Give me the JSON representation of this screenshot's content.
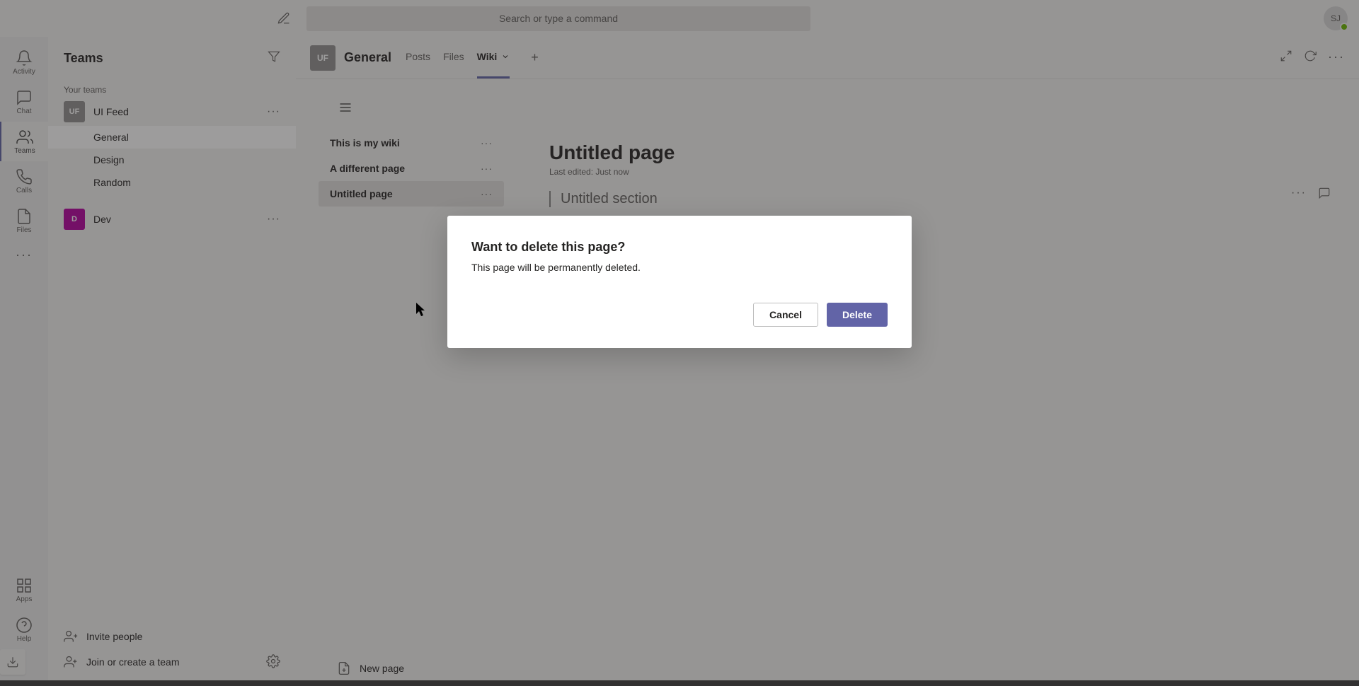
{
  "title_bar": {
    "search_placeholder": "Search or type a command",
    "user_initials": "SJ"
  },
  "app_rail": {
    "items": [
      {
        "label": "Activity"
      },
      {
        "label": "Chat"
      },
      {
        "label": "Teams"
      },
      {
        "label": "Calls"
      },
      {
        "label": "Files"
      }
    ],
    "help_label": "Help"
  },
  "sidebar": {
    "title": "Teams",
    "section_label": "Your teams",
    "teams": [
      {
        "avatar": "UF",
        "name": "UI Feed",
        "channels": [
          "General",
          "Design",
          "Random"
        ]
      },
      {
        "avatar": "D",
        "name": "Dev"
      }
    ],
    "invite_label": "Invite people",
    "join_label": "Join or create a team"
  },
  "channel_header": {
    "avatar": "UF",
    "name": "General",
    "tabs": [
      "Posts",
      "Files",
      "Wiki"
    ]
  },
  "wiki": {
    "pages": [
      {
        "title": "This is my wiki"
      },
      {
        "title": "A different page"
      },
      {
        "title": "Untitled page"
      }
    ],
    "new_page_label": "New page",
    "page_title": "Untitled page",
    "last_edited": "Last edited: Just now",
    "section_title": "Untitled section"
  },
  "modal": {
    "title": "Want to delete this page?",
    "message": "This page will be permanently deleted.",
    "cancel_label": "Cancel",
    "confirm_label": "Delete"
  }
}
